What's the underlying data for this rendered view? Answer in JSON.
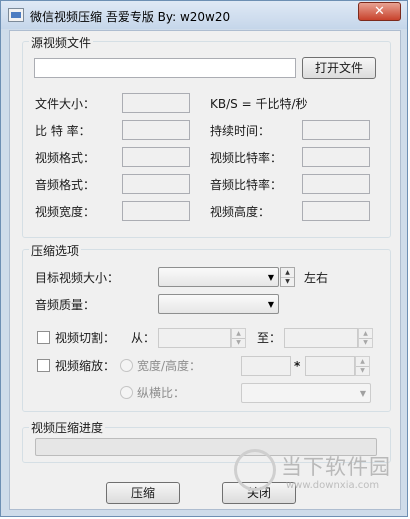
{
  "window": {
    "title": "微信视频压缩  吾爱专版 By: w20w20",
    "close_glyph": "✕"
  },
  "source": {
    "group_label": "源视频文件",
    "file_path": "",
    "open_button": "打开文件",
    "labels": {
      "file_size": "文件大小：",
      "kbs_note": "KB/S = 千比特/秒",
      "bitrate": "比 特 率：",
      "duration": "持续时间：",
      "video_format": "视频格式：",
      "video_bitrate": "视频比特率：",
      "audio_format": "音频格式：",
      "audio_bitrate": "音频比特率：",
      "video_width": "视频宽度：",
      "video_height": "视频高度："
    }
  },
  "compress": {
    "group_label": "压缩选项",
    "target_size_label": "目标视频大小：",
    "target_size_value": "",
    "approx_label": "左右",
    "audio_quality_label": "音频质量：",
    "audio_quality_value": "",
    "cut_label": "视频切割：",
    "cut_checked": false,
    "from_label": "从：",
    "to_label": "至：",
    "scale_label": "视频缩放：",
    "scale_checked": false,
    "wh_radio_label": "宽度/高度：",
    "times_sign": "*",
    "ratio_radio_label": "纵横比："
  },
  "progress": {
    "group_label": "视频压缩进度",
    "value_percent": 0
  },
  "buttons": {
    "compress": "压缩",
    "close": "关闭"
  },
  "watermark": {
    "brand": "当下软件园",
    "url": "www.downxia.com"
  }
}
